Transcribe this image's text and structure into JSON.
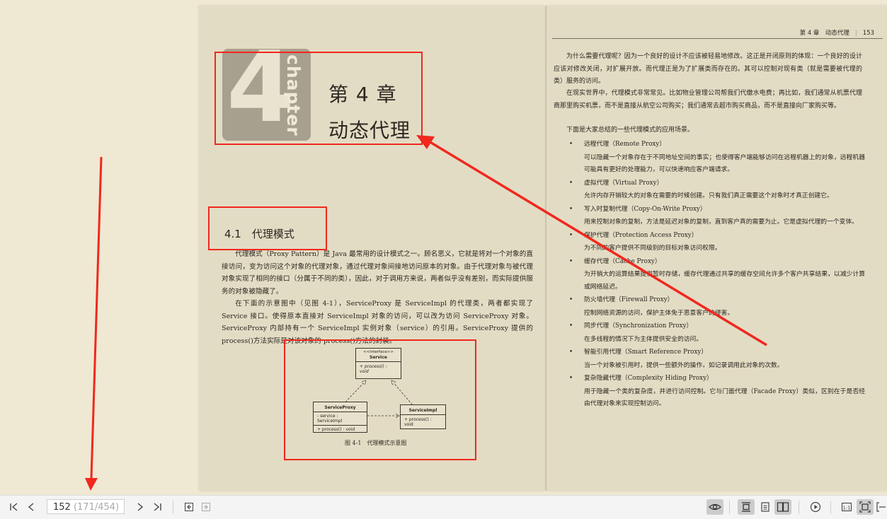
{
  "left_page": {
    "chapter_number": "4",
    "chapter_word": "chapter",
    "chapter_label": "第 4 章",
    "chapter_title": "动态代理",
    "section_title": "4.1　代理模式",
    "paragraphs": [
      "代理模式（Proxy Pattern）是 Java 最常用的设计模式之一。顾名思义，它就是将对一个对象的直接访问，变为访问这个对象的代理对象，通过代理对象间接地访问原本的对象。由于代理对象与被代理对象实现了相同的接口（分属于不同的类），因此，对于调用方来说，两者似乎没有差别，而实际提供服务的对象被隐藏了。",
      "在下面的示意图中（见图 4-1），ServiceProxy 是 ServiceImpl 的代理类，两者都实现了 Service 接口。使得原本直接对 ServiceImpl 对象的访问，可以改为访问 ServiceProxy 对象。ServiceProxy 内部持有一个 ServiceImpl 实例对象（service）的引用。ServiceProxy 提供的 process()方法实际是对该对象的 process()方法的封装。"
    ],
    "uml": {
      "interface_stereotype": "<<interface>>",
      "interface_name": "Service",
      "interface_method": "+ process() : void",
      "proxy_name": "ServiceProxy",
      "proxy_field": "- service : ServiceImpl",
      "proxy_method": "+ process() : void",
      "impl_name": "ServiceImpl",
      "impl_method": "+ process() : void"
    },
    "figure_caption": "图 4-1　代理模式示意图"
  },
  "right_page": {
    "running_head": "第 4 章　动态代理",
    "page_number": "153",
    "paragraphs": [
      "为什么需要代理呢？因为一个良好的设计不应该被轻易地修改。这正是开闭原则的体现：一个良好的设计应该对修改关闭，对扩展开放。而代理正是为了扩展类而存在的。其可以控制对现有类（就是需要被代理的类）服务的访问。",
      "在现实世界中，代理模式非常常见。比如物业管理公司帮我们代缴水电费；再比如，我们通常从机票代理商那里购买机票，而不是直接从航空公司购买；我们通常去超市购买商品，而不是直接向厂家购买等。",
      "下面是大家总结的一些代理模式的应用场景。"
    ],
    "bullet": "•",
    "proxies": [
      {
        "name": "远程代理（Remote Proxy）",
        "desc": "可以隐藏一个对象存在于不同地址空间的事实；也使得客户端能够访问在远程机器上的对象，远程机器可能具有更好的处理能力，可以快速响应客户端请求。"
      },
      {
        "name": "虚拟代理（Virtual Proxy）",
        "desc": "允许内存开销较大的对象在需要的时候创建。只有我们真正需要这个对象时才真正创建它。"
      },
      {
        "name": "写入时复制代理（Copy-On-Write Proxy）",
        "desc": "用来控制对象的复制，方法是延迟对象的复制，直到客户真的需要为止。它是虚拟代理的一个变体。"
      },
      {
        "name": "保护代理（Protection Access Proxy）",
        "desc": "为不同的客户提供不同级别的目标对象访问权限。"
      },
      {
        "name": "缓存代理（Cache Proxy）",
        "desc": "为开销大的运算结果提供暂时存储，缓存代理通过共享的缓存空间允许多个客户共享结果，以减少计算或网络延迟。"
      },
      {
        "name": "防火墙代理（Firewall Proxy）",
        "desc": "控制网络资源的访问，保护主体免于恶意客户的侵害。"
      },
      {
        "name": "同步代理（Synchronization Proxy）",
        "desc": "在多线程的情况下为主体提供安全的访问。"
      },
      {
        "name": "智能引用代理（Smart Reference Proxy）",
        "desc": "当一个对象被引用时，提供一些额外的操作，如记录调用此对象的次数。"
      },
      {
        "name": "复杂隐藏代理（Complexity Hiding Proxy）",
        "desc": "用于隐藏一个类的复杂度，并进行访问控制。它与门面代理（Facade Proxy）类似，区别在于是否经由代理对象来实现控制访问。"
      }
    ]
  },
  "toolbar": {
    "current_page": "152",
    "page_detail": "(171/454)",
    "icons": [
      "first-page-icon",
      "prev-page-icon",
      "next-page-icon",
      "last-page-icon",
      "back-icon",
      "forward-icon",
      "eye-comfort-icon",
      "single-page-icon",
      "continuous-page-icon",
      "two-page-icon",
      "play-icon",
      "actual-size-icon",
      "fit-page-icon",
      "fit-width-icon"
    ]
  },
  "colors": {
    "annotation": "#f0281e",
    "page_bg": "#e3dcc4",
    "viewer_bg": "#efe8d2",
    "toolbar_bg": "#f4f4f4"
  }
}
